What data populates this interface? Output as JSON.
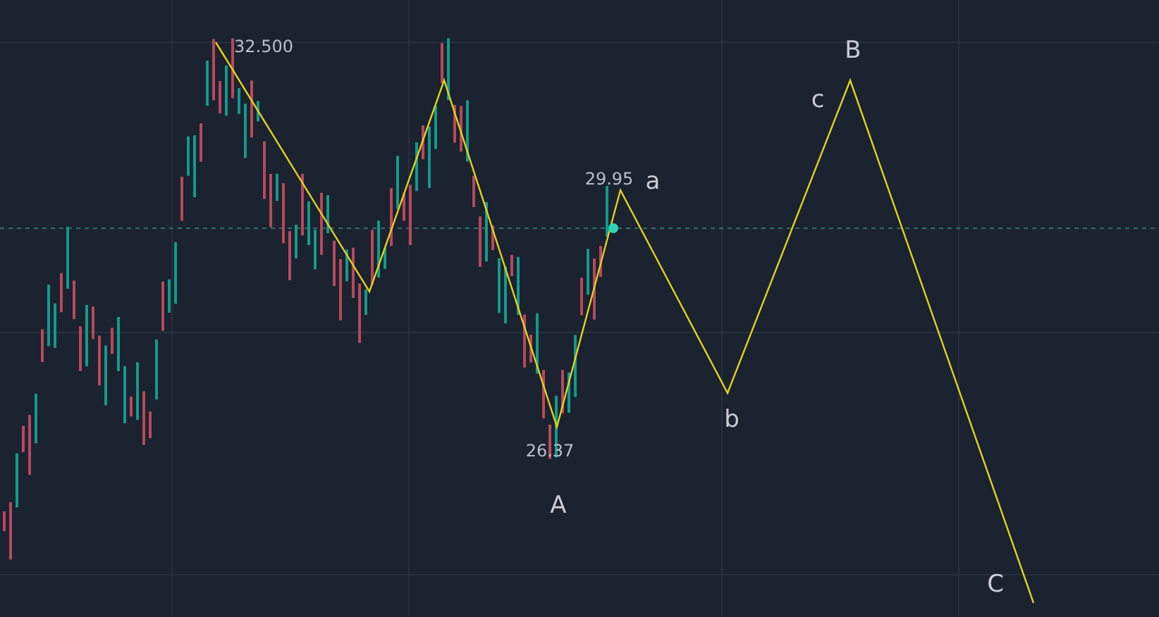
{
  "price_labels": [
    {
      "text": "32.500"
    },
    {
      "text": "29.95"
    },
    {
      "text": "26.37"
    }
  ],
  "wave_labels": [
    {
      "text": "a"
    },
    {
      "text": "b"
    },
    {
      "text": "c"
    },
    {
      "text": "A"
    },
    {
      "text": "B"
    },
    {
      "text": "C"
    }
  ]
}
